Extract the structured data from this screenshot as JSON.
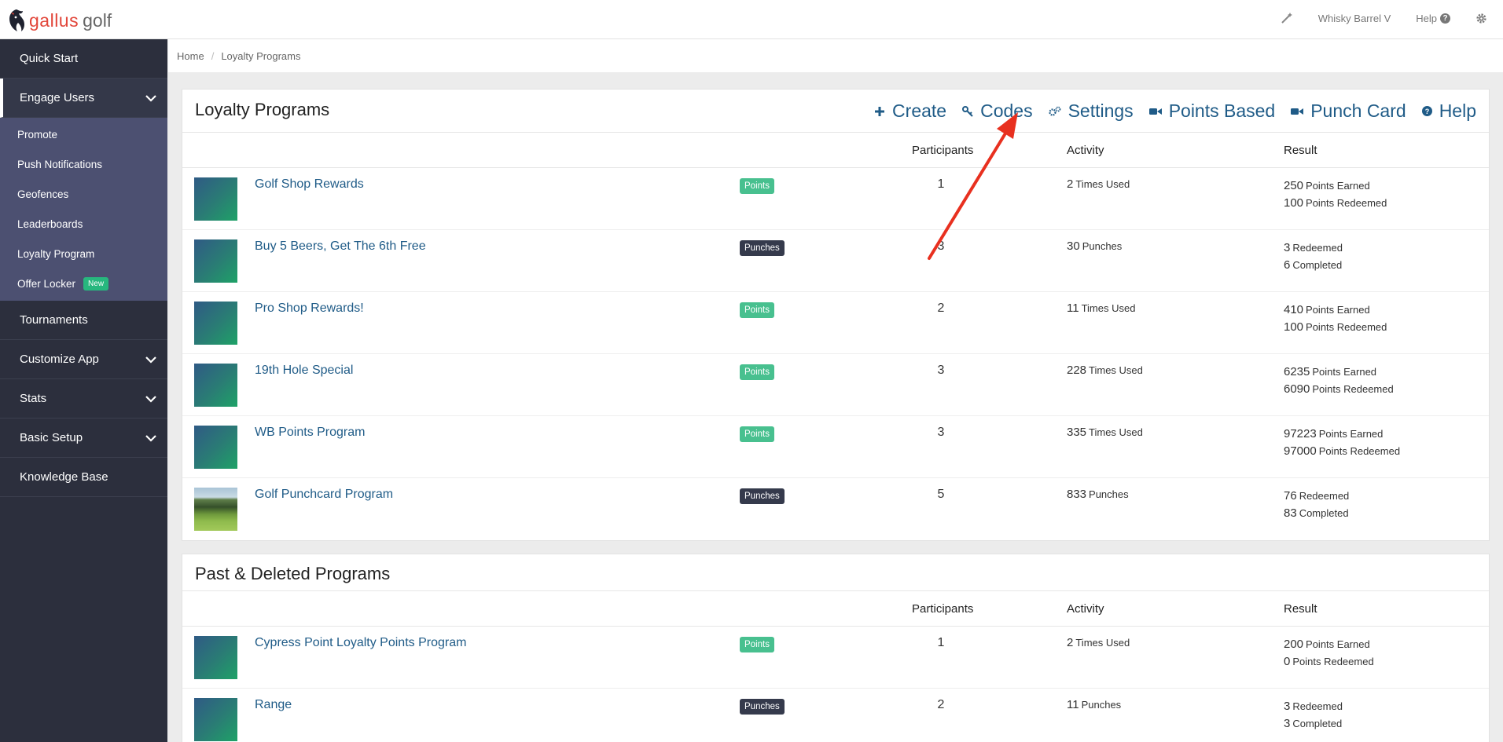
{
  "header": {
    "logo_gallus": "gallus",
    "logo_golf": "golf",
    "account_name": "Whisky Barrel V",
    "help_label": "Help",
    "icons": [
      "wand-icon",
      "question-circle-icon",
      "gear-icon"
    ]
  },
  "sidebar": {
    "quick_start": "Quick Start",
    "engage_users": "Engage Users",
    "sub_items": [
      "Promote",
      "Push Notifications",
      "Geofences",
      "Leaderboards",
      "Loyalty Program",
      "Offer Locker"
    ],
    "offer_locker_badge": "New",
    "tournaments": "Tournaments",
    "customize_app": "Customize App",
    "stats": "Stats",
    "basic_setup": "Basic Setup",
    "knowledge_base": "Knowledge Base"
  },
  "breadcrumb": {
    "home": "Home",
    "separator": "/",
    "current": "Loyalty Programs"
  },
  "loyalty": {
    "title": "Loyalty Programs",
    "actions": [
      "Create",
      "Codes",
      "Settings",
      "Points Based",
      "Punch Card",
      "Help"
    ],
    "columns": {
      "participants": "Participants",
      "activity": "Activity",
      "result": "Result"
    },
    "rows": [
      {
        "name": "Golf Shop Rewards",
        "type": "Points",
        "participants": "1",
        "activity_value": "2",
        "activity_unit": "Times Used",
        "result1_value": "250",
        "result1_unit": "Points Earned",
        "result2_value": "100",
        "result2_unit": "Points Redeemed"
      },
      {
        "name": "Buy 5 Beers, Get The 6th Free",
        "type": "Punches",
        "participants": "3",
        "activity_value": "30",
        "activity_unit": "Punches",
        "result1_value": "3",
        "result1_unit": "Redeemed",
        "result2_value": "6",
        "result2_unit": "Completed"
      },
      {
        "name": "Pro Shop Rewards!",
        "type": "Points",
        "participants": "2",
        "activity_value": "11",
        "activity_unit": "Times Used",
        "result1_value": "410",
        "result1_unit": "Points Earned",
        "result2_value": "100",
        "result2_unit": "Points Redeemed"
      },
      {
        "name": "19th Hole Special",
        "type": "Points",
        "participants": "3",
        "activity_value": "228",
        "activity_unit": "Times Used",
        "result1_value": "6235",
        "result1_unit": "Points Earned",
        "result2_value": "6090",
        "result2_unit": "Points Redeemed"
      },
      {
        "name": "WB Points Program",
        "type": "Points",
        "participants": "3",
        "activity_value": "335",
        "activity_unit": "Times Used",
        "result1_value": "97223",
        "result1_unit": "Points Earned",
        "result2_value": "97000",
        "result2_unit": "Points Redeemed"
      },
      {
        "name": "Golf Punchcard Program",
        "type": "Punches",
        "participants": "5",
        "activity_value": "833",
        "activity_unit": "Punches",
        "result1_value": "76",
        "result1_unit": "Redeemed",
        "result2_value": "83",
        "result2_unit": "Completed"
      }
    ]
  },
  "past": {
    "title": "Past & Deleted Programs",
    "columns": {
      "participants": "Participants",
      "activity": "Activity",
      "result": "Result"
    },
    "rows": [
      {
        "name": "Cypress Point Loyalty Points Program",
        "type": "Points",
        "participants": "1",
        "activity_value": "2",
        "activity_unit": "Times Used",
        "result1_value": "200",
        "result1_unit": "Points Earned",
        "result2_value": "0",
        "result2_unit": "Points Redeemed"
      },
      {
        "name": "Range",
        "type": "Punches",
        "participants": "2",
        "activity_value": "11",
        "activity_unit": "Punches",
        "result1_value": "3",
        "result1_unit": "Redeemed",
        "result2_value": "3",
        "result2_unit": "Completed"
      }
    ]
  },
  "colors": {
    "sidebar_bg": "#2c2f3d",
    "submenu_bg": "#4c5071",
    "link": "#1f5b87",
    "points_badge": "#48c08f",
    "punches_badge": "#353a4c",
    "annotation_arrow": "#e8301f"
  }
}
